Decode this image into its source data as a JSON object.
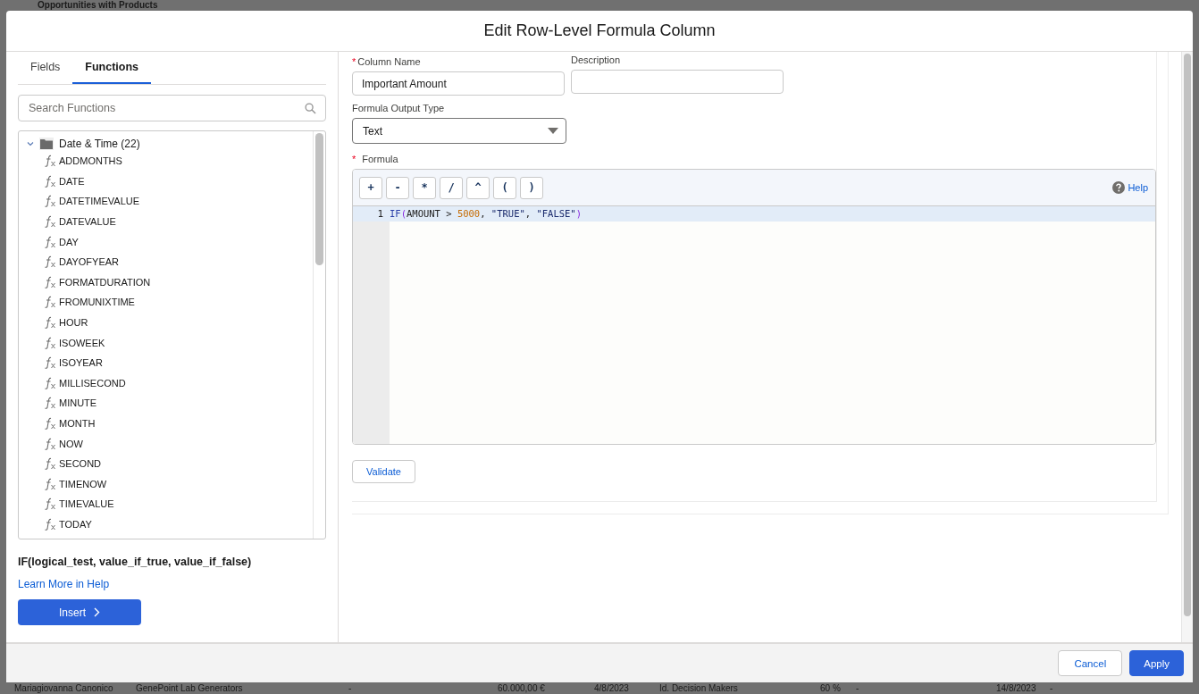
{
  "background": {
    "title": "Opportunities with Products",
    "row": [
      "Mariagiovanna Canonico",
      "GenePoint Lab Generators",
      "-",
      "60.000,00 €",
      "4/8/2023",
      "Id. Decision Makers",
      "60 %",
      "-",
      "14/8/2023",
      "-"
    ]
  },
  "dialog": {
    "title": "Edit Row-Level Formula Column",
    "tabs": [
      {
        "label": "Fields",
        "selected": false
      },
      {
        "label": "Functions",
        "selected": true
      }
    ],
    "search": {
      "placeholder": "Search Functions"
    },
    "tree": {
      "label": "Date & Time (22)",
      "expanded": true,
      "children": [
        {
          "label": "ADDMONTHS"
        },
        {
          "label": "DATE"
        },
        {
          "label": "DATETIMEVALUE"
        },
        {
          "label": "DATEVALUE"
        },
        {
          "label": "DAY"
        },
        {
          "label": "DAYOFYEAR"
        },
        {
          "label": "FORMATDURATION"
        },
        {
          "label": "FROMUNIXTIME"
        },
        {
          "label": "HOUR"
        },
        {
          "label": "ISOWEEK"
        },
        {
          "label": "ISOYEAR"
        },
        {
          "label": "MILLISECOND"
        },
        {
          "label": "MINUTE"
        },
        {
          "label": "MONTH"
        },
        {
          "label": "NOW"
        },
        {
          "label": "SECOND"
        },
        {
          "label": "TIMENOW"
        },
        {
          "label": "TIMEVALUE"
        },
        {
          "label": "TODAY"
        }
      ]
    },
    "signature": "IF(logical_test, value_if_true, value_if_false)",
    "help_link": "Learn More in Help",
    "insert_button": "Insert",
    "column_name": {
      "label": "Column Name",
      "required": true,
      "value": "Important Amount"
    },
    "description": {
      "label": "Description"
    },
    "output_type": {
      "label": "Formula Output Type",
      "value": "Text"
    },
    "formula": {
      "label": "Formula",
      "required": true,
      "operators": [
        "+",
        "-",
        "*",
        "/",
        "^",
        "(",
        ")"
      ],
      "help": "Help",
      "lines": [
        {
          "number": "1",
          "tokens": [
            {
              "kind": "function",
              "text": "IF"
            },
            {
              "kind": "paren",
              "text": "("
            },
            {
              "kind": "plain",
              "text": "AMOUNT > "
            },
            {
              "kind": "number",
              "text": "5000"
            },
            {
              "kind": "plain",
              "text": ", "
            },
            {
              "kind": "string",
              "text": "\"TRUE\""
            },
            {
              "kind": "plain",
              "text": ", "
            },
            {
              "kind": "string",
              "text": "\"FALSE\""
            },
            {
              "kind": "paren",
              "text": ")"
            }
          ]
        }
      ]
    },
    "validate_button": "Validate",
    "buttons": [
      {
        "label": "Cancel",
        "kind": "neutral"
      },
      {
        "label": "Apply",
        "kind": "brand"
      }
    ]
  }
}
